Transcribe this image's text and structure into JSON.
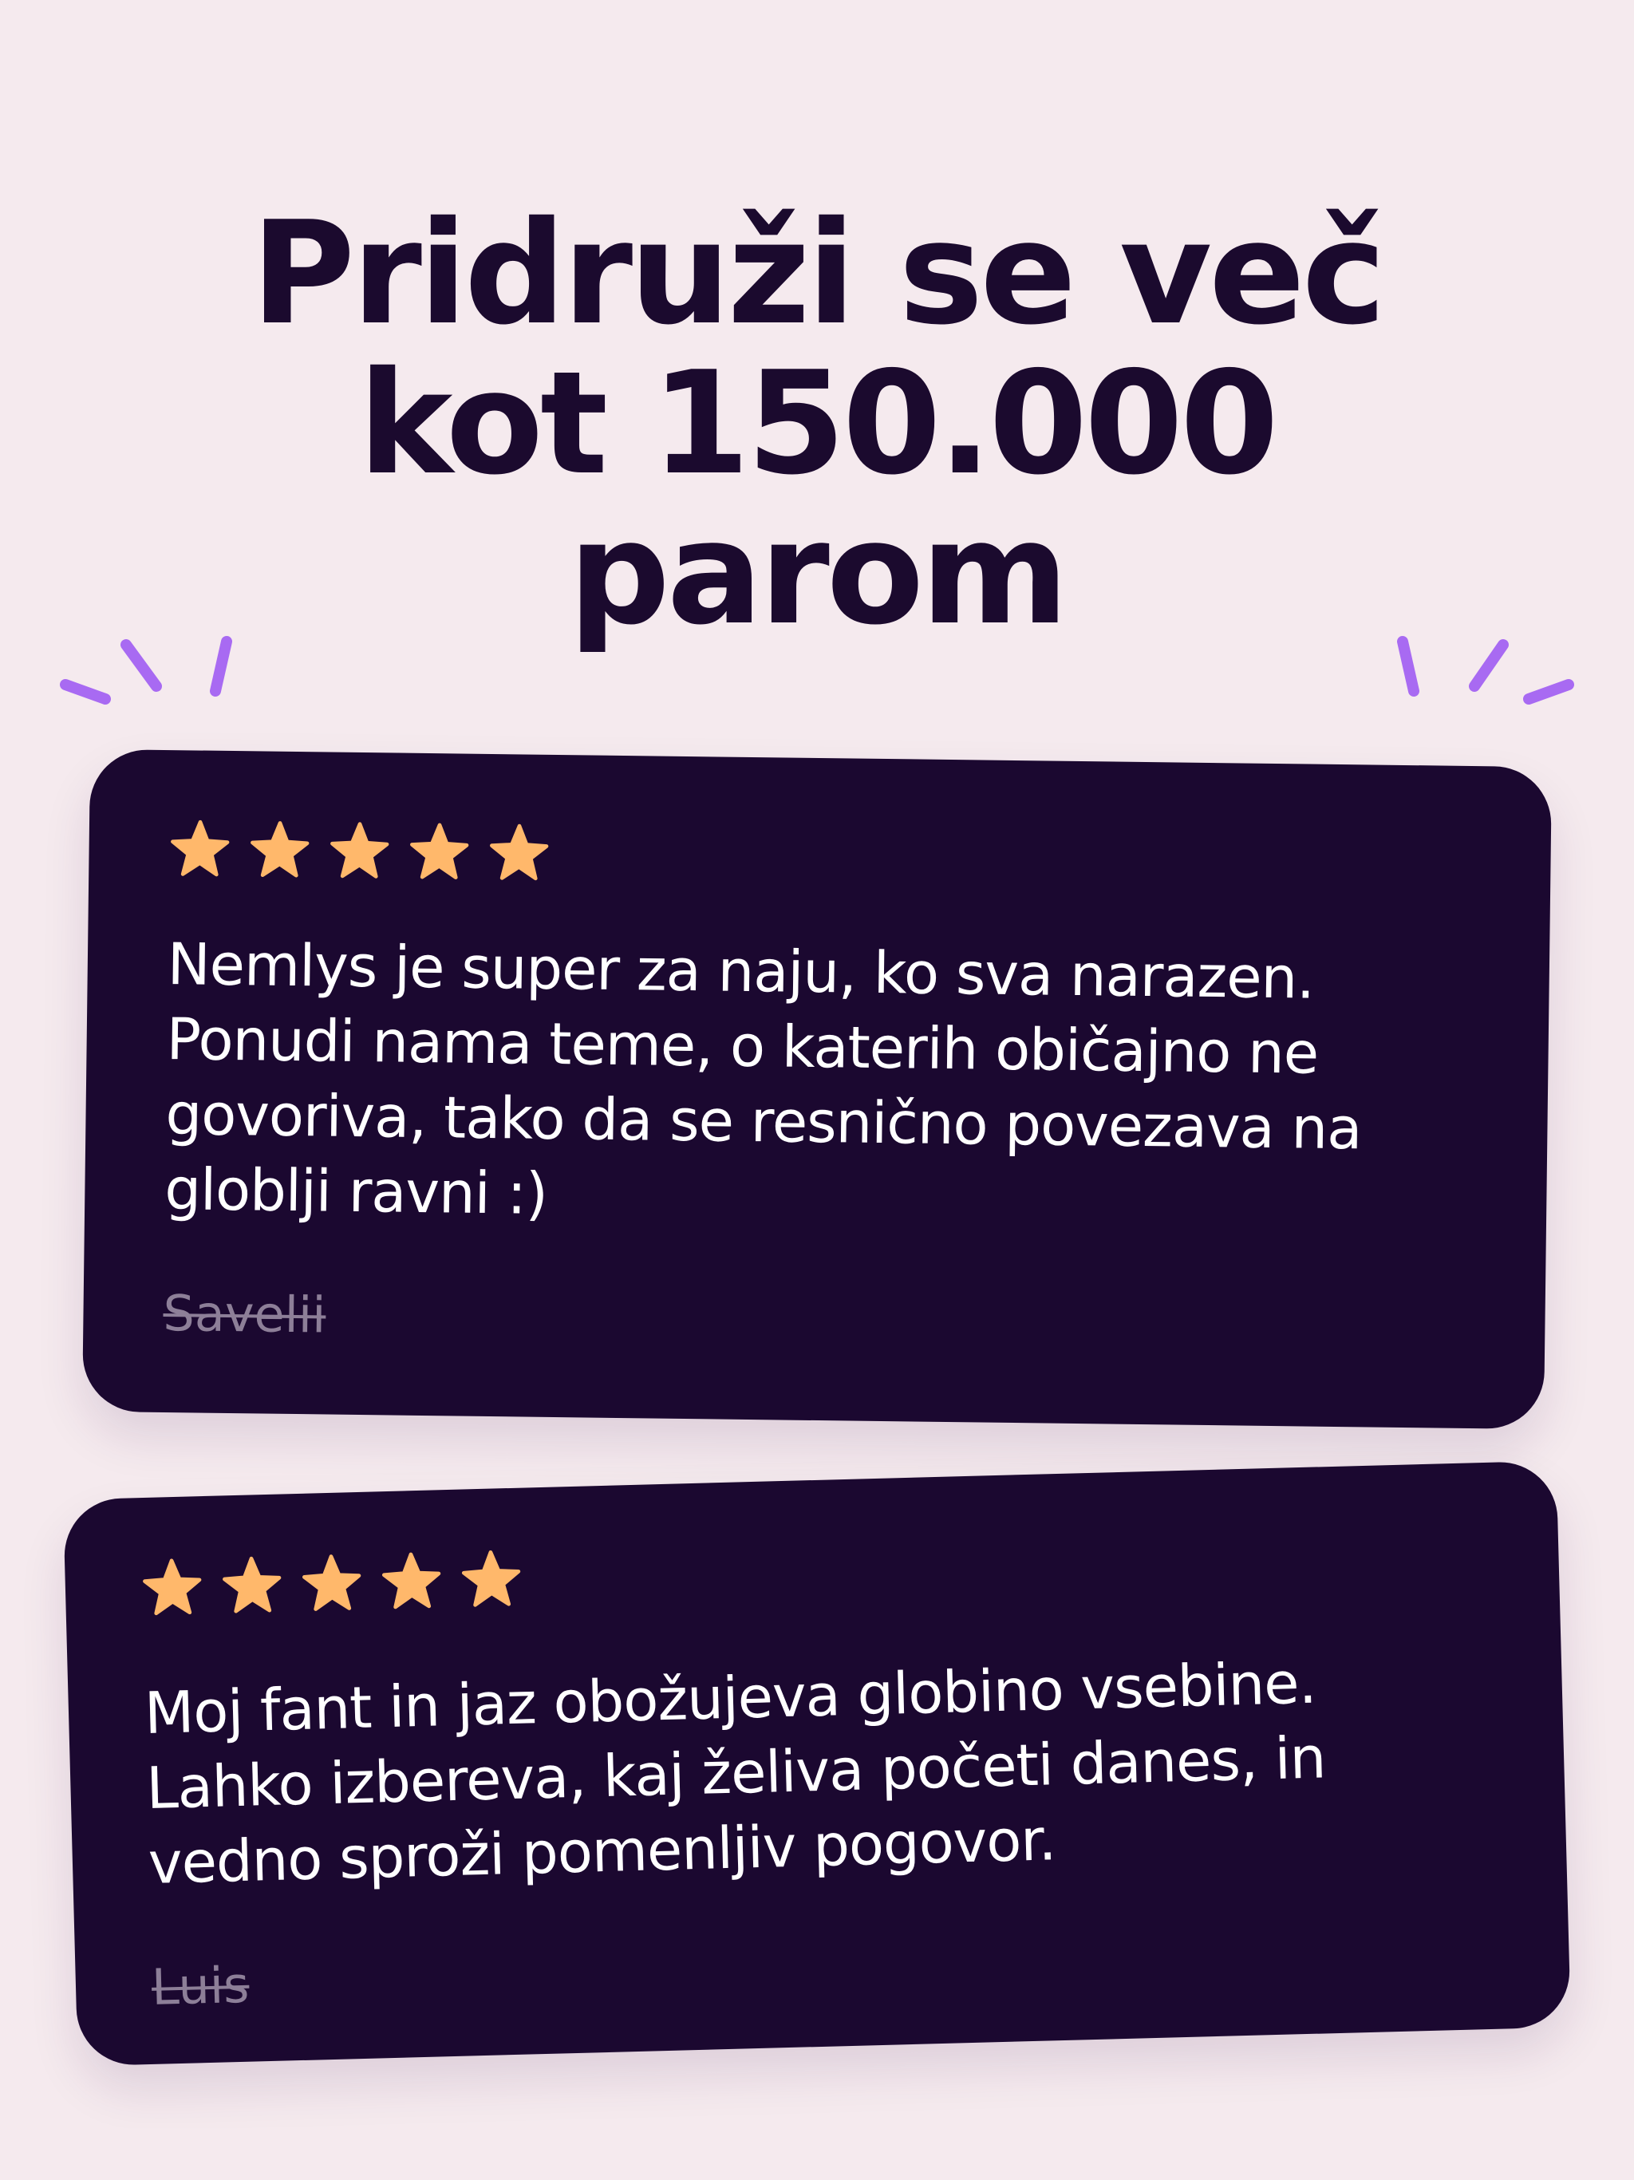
{
  "headline": {
    "line1": "Pridruži se več",
    "line2": "kot 150.000",
    "line3": "parom"
  },
  "colors": {
    "background": "#f5eaee",
    "heading": "#1b0a2e",
    "card": "#1b0830",
    "star": "#ffb86b",
    "sparkle": "#a86af2",
    "reviewer": "#8d7f98"
  },
  "icons": {
    "star": "star-icon",
    "sparkle": "sparkle-icon"
  },
  "reviews": [
    {
      "rating": 5,
      "text": "Nemlys je super za naju, ko sva narazen. Ponudi nama teme, o katerih običajno ne govoriva, tako da se resnično povezava na globlji ravni :)",
      "author": "Savelii"
    },
    {
      "rating": 5,
      "text": "Moj fant in jaz obožujeva globino vsebine. Lahko izbereva, kaj želiva početi danes, in vedno sproži pomenljiv pogovor.",
      "author": "Luis"
    }
  ]
}
